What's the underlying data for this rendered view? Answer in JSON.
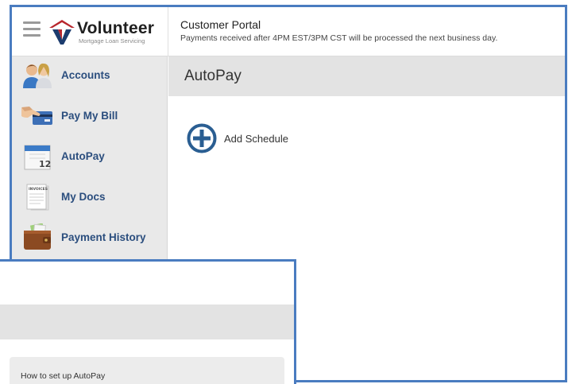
{
  "brand": {
    "name": "Volunteer",
    "tagline": "Mortgage Loan Servicing"
  },
  "header": {
    "title": "Customer Portal",
    "notice": "Payments received after 4PM EST/3PM CST will be processed the next business day."
  },
  "sidebar": {
    "items": [
      {
        "label": "Accounts",
        "icon": "users-icon"
      },
      {
        "label": "Pay My Bill",
        "icon": "credit-card-icon"
      },
      {
        "label": "AutoPay",
        "icon": "calendar-icon"
      },
      {
        "label": "My Docs",
        "icon": "invoice-document-icon"
      },
      {
        "label": "Payment History",
        "icon": "wallet-icon"
      }
    ]
  },
  "calendar_icon_day": "12",
  "invoice_icon_text": "INVOICES",
  "main": {
    "page_title": "AutoPay",
    "add_schedule_label": "Add Schedule"
  },
  "inset": {
    "card_title": "How to set up AutoPay"
  },
  "colors": {
    "frame_border": "#4a7cc0",
    "nav_label": "#2b4e7e",
    "add_icon": "#2a5e92"
  }
}
